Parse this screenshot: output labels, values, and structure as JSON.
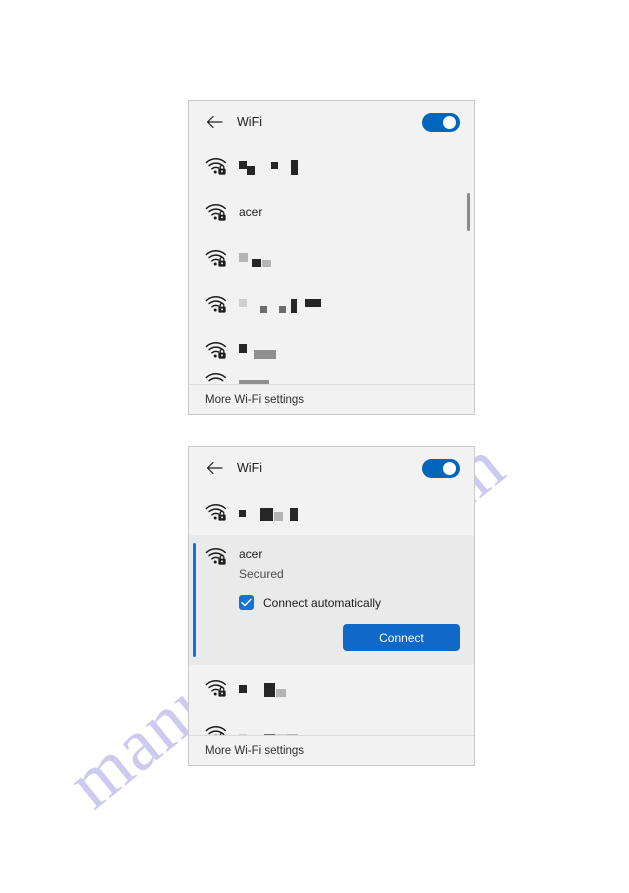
{
  "watermark": {
    "text": "manualshive.com",
    "color": "#cdcaf0"
  },
  "colors": {
    "accent_blue": "#1273d4",
    "toggle_on": "#0066bd",
    "button_blue": "#0f69c9",
    "panel_bg": "#f2f2f2",
    "selected_bg": "#eaeaea",
    "page_bg": "#ffffff"
  },
  "panels": [
    {
      "id": "wifi-flyout-collapsed",
      "header": {
        "back_icon": "back-arrow-icon",
        "title": "WiFi",
        "toggle": {
          "state": "on",
          "label": "WiFi toggle"
        }
      },
      "networks": [
        {
          "icon": "wifi-secured-icon",
          "ssid": "",
          "redacted": true,
          "blocks": [
            {
              "w": 8,
              "h": 8,
              "tone": "dark",
              "gap": 0,
              "y": 0
            },
            {
              "w": 8,
              "h": 9,
              "tone": "dark",
              "gap": 0,
              "y": 5
            },
            {
              "w": 7,
              "h": 7,
              "tone": "dark",
              "gap": 14,
              "y": 0
            },
            {
              "w": 7,
              "h": 15,
              "tone": "dark",
              "gap": 10,
              "y": 0
            }
          ]
        },
        {
          "icon": "wifi-secured-icon",
          "ssid": "acer",
          "redacted": false
        },
        {
          "icon": "wifi-secured-icon",
          "ssid": "",
          "redacted": true,
          "blocks": [
            {
              "w": 9,
              "h": 9,
              "tone": "g2",
              "gap": 0,
              "y": 0
            },
            {
              "w": 9,
              "h": 8,
              "tone": "dark",
              "gap": 4,
              "y": 4
            },
            {
              "w": 9,
              "h": 7,
              "tone": "g2",
              "gap": 0,
              "y": 4
            }
          ]
        },
        {
          "icon": "wifi-secured-icon",
          "ssid": "",
          "redacted": true,
          "blocks": [
            {
              "w": 8,
              "h": 8,
              "tone": "g3",
              "gap": 0,
              "y": 0
            },
            {
              "w": 7,
              "h": 7,
              "tone": "g4",
              "gap": 10,
              "y": 4
            },
            {
              "w": 7,
              "h": 7,
              "tone": "g4",
              "gap": 9,
              "y": 4
            },
            {
              "w": 6,
              "h": 14,
              "tone": "dark",
              "gap": 2,
              "y": 0
            },
            {
              "w": 16,
              "h": 8,
              "tone": "dark",
              "gap": 5,
              "y": 0
            }
          ]
        },
        {
          "icon": "wifi-secured-icon",
          "ssid": "",
          "redacted": true,
          "blocks": [
            {
              "w": 8,
              "h": 9,
              "tone": "dark",
              "gap": 0,
              "y": 0
            },
            {
              "w": 22,
              "h": 9,
              "tone": "g1",
              "gap": 4,
              "y": 6
            }
          ]
        },
        {
          "icon": "wifi-open-icon",
          "ssid": "",
          "redacted": true,
          "clipped": true,
          "blocks": [
            {
              "w": 30,
              "h": 10,
              "tone": "g1",
              "gap": 0,
              "y": 0
            }
          ]
        }
      ],
      "footer": {
        "label": "More Wi-Fi settings"
      },
      "scrollbar": true
    },
    {
      "id": "wifi-flyout-expanded",
      "header": {
        "back_icon": "back-arrow-icon",
        "title": "WiFi",
        "toggle": {
          "state": "on",
          "label": "WiFi toggle"
        }
      },
      "networks": [
        {
          "icon": "wifi-secured-icon",
          "ssid": "",
          "redacted": true,
          "blocks": [
            {
              "w": 7,
              "h": 7,
              "tone": "dark",
              "gap": 0,
              "y": 0
            },
            {
              "w": 13,
              "h": 13,
              "tone": "dark",
              "gap": 11,
              "y": 0
            },
            {
              "w": 9,
              "h": 9,
              "tone": "g2",
              "gap": 0,
              "y": 4
            },
            {
              "w": 8,
              "h": 13,
              "tone": "dark",
              "gap": 4,
              "y": 0
            }
          ]
        }
      ],
      "selected_network": {
        "icon": "wifi-secured-icon",
        "ssid": "acer",
        "security": "Secured",
        "checkbox": {
          "label": "Connect automatically",
          "checked": true,
          "icon": "checkmark-icon"
        },
        "primary_button": "Connect"
      },
      "networks_after": [
        {
          "icon": "wifi-secured-icon",
          "ssid": "",
          "redacted": true,
          "blocks": [
            {
              "w": 8,
              "h": 8,
              "tone": "dark",
              "gap": 0,
              "y": 0
            },
            {
              "w": 11,
              "h": 14,
              "tone": "dark",
              "gap": 14,
              "y": 0
            },
            {
              "w": 10,
              "h": 8,
              "tone": "g2",
              "gap": 0,
              "y": 0
            }
          ]
        },
        {
          "icon": "wifi-secured-icon",
          "ssid": "",
          "redacted": true,
          "blocks": [
            {
              "w": 8,
              "h": 9,
              "tone": "g3",
              "gap": 0,
              "y": 0
            },
            {
              "w": 11,
              "h": 9,
              "tone": "g4",
              "gap": 14,
              "y": 0
            },
            {
              "w": 12,
              "h": 9,
              "tone": "g3",
              "gap": 0,
              "y": 0
            },
            {
              "w": 11,
              "h": 9,
              "tone": "g2",
              "gap": 0,
              "y": 0
            }
          ]
        }
      ],
      "footer": {
        "label": "More Wi-Fi settings"
      }
    }
  ]
}
